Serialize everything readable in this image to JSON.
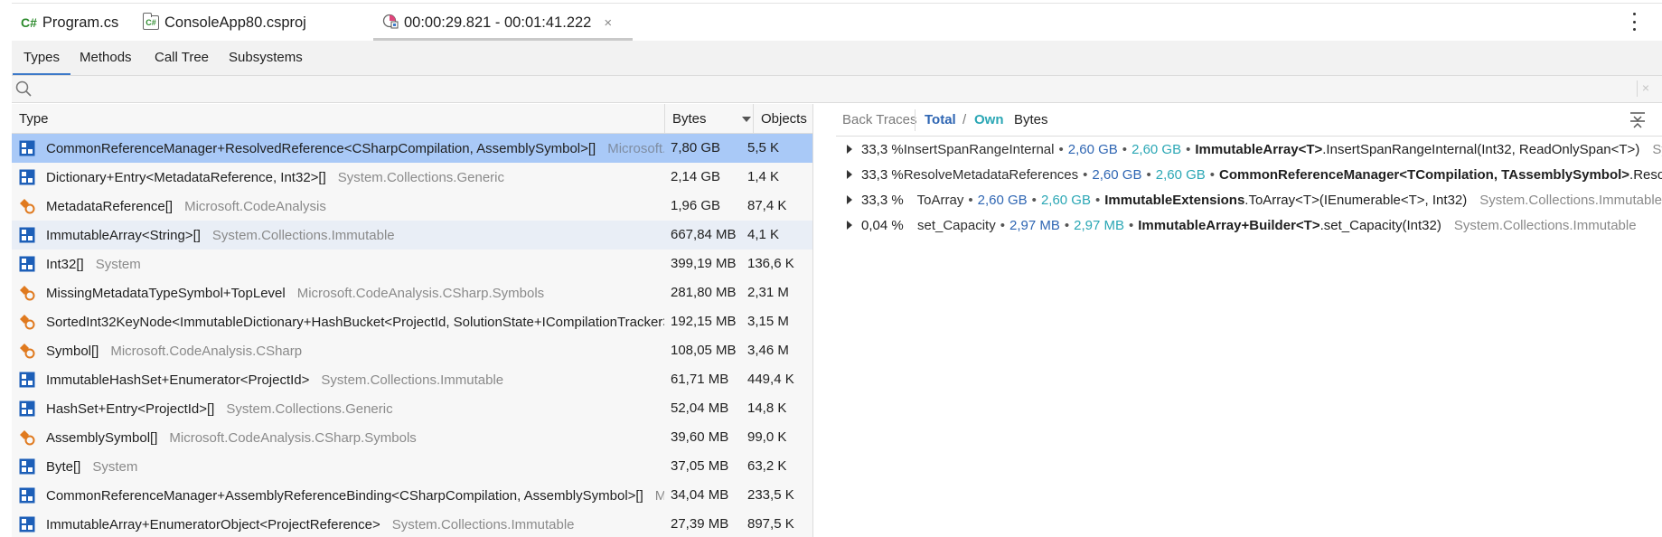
{
  "file_tabs": [
    {
      "icon": "csharp-file-icon",
      "badge": "C#",
      "label": "Program.cs"
    },
    {
      "icon": "csproj-file-icon",
      "badge": "C#",
      "label": "ConsoleApp80.csproj"
    },
    {
      "icon": "memory-snapshot-icon",
      "label": "00:00:29.821 - 00:01:41.222",
      "close": "×"
    }
  ],
  "view_tabs": [
    "Types",
    "Methods",
    "Call Tree",
    "Subsystems"
  ],
  "active_view_tab": "Types",
  "search": {
    "value": "",
    "placeholder": "",
    "clear": "×"
  },
  "table": {
    "columns": {
      "type": "Type",
      "bytes": "Bytes",
      "objects": "Objects"
    },
    "rows": [
      {
        "icon": "class-icon",
        "name": "CommonReferenceManager+ResolvedReference<CSharpCompilation, AssemblySymbol>[]",
        "ns": "Microsoft.CodeAnalysis",
        "bytes": "7,80 GB",
        "objects": "5,5 K",
        "selected": true
      },
      {
        "icon": "class-icon",
        "name": "Dictionary+Entry<MetadataReference, Int32>[]",
        "ns": "System.Collections.Generic",
        "bytes": "2,14 GB",
        "objects": "1,4 K"
      },
      {
        "icon": "abstract-class-icon",
        "name": "MetadataReference[]",
        "ns": "Microsoft.CodeAnalysis",
        "bytes": "1,96 GB",
        "objects": "87,4 K"
      },
      {
        "icon": "class-icon",
        "name": "ImmutableArray<String>[]",
        "ns": "System.Collections.Immutable",
        "bytes": "667,84 MB",
        "objects": "4,1 K",
        "hover": true
      },
      {
        "icon": "class-icon",
        "name": "Int32[]",
        "ns": "System",
        "bytes": "399,19 MB",
        "objects": "136,6 K"
      },
      {
        "icon": "abstract-class-icon",
        "name": "MissingMetadataTypeSymbol+TopLevel",
        "ns": "Microsoft.CodeAnalysis.CSharp.Symbols",
        "bytes": "281,80 MB",
        "objects": "2,31 M"
      },
      {
        "icon": "abstract-class-icon",
        "name": "SortedInt32KeyNode<ImmutableDictionary+HashBucket<ProjectId, SolutionState+ICompilationTracker>>",
        "ns": "",
        "bytes": "192,15 MB",
        "objects": "3,15 M"
      },
      {
        "icon": "abstract-class-icon",
        "name": "Symbol[]",
        "ns": "Microsoft.CodeAnalysis.CSharp",
        "bytes": "108,05 MB",
        "objects": "3,46 M"
      },
      {
        "icon": "class-icon",
        "name": "ImmutableHashSet+Enumerator<ProjectId>",
        "ns": "System.Collections.Immutable",
        "bytes": "61,71 MB",
        "objects": "449,4 K"
      },
      {
        "icon": "class-icon",
        "name": "HashSet+Entry<ProjectId>[]",
        "ns": "System.Collections.Generic",
        "bytes": "52,04 MB",
        "objects": "14,8 K"
      },
      {
        "icon": "abstract-class-icon",
        "name": "AssemblySymbol[]",
        "ns": "Microsoft.CodeAnalysis.CSharp.Symbols",
        "bytes": "39,60 MB",
        "objects": "99,0 K"
      },
      {
        "icon": "class-icon",
        "name": "Byte[]",
        "ns": "System",
        "bytes": "37,05 MB",
        "objects": "63,2 K"
      },
      {
        "icon": "class-icon",
        "name": "CommonReferenceManager+AssemblyReferenceBinding<CSharpCompilation, AssemblySymbol>[]",
        "ns": "Microsoft.CodeAnalysis",
        "bytes": "34,04 MB",
        "objects": "233,5 K"
      },
      {
        "icon": "class-icon",
        "name": "ImmutableArray+EnumeratorObject<ProjectReference>",
        "ns": "System.Collections.Immutable",
        "bytes": "27,39 MB",
        "objects": "897,5 K"
      }
    ]
  },
  "back_traces": {
    "header": {
      "back_traces": "Back Traces",
      "total": "Total",
      "slash": "/",
      "own": "Own",
      "bytes": "Bytes"
    },
    "rows": [
      {
        "pct": "33,3 %",
        "method": "InsertSpanRangeInternal",
        "total": "2,60 GB",
        "own": "2,60 GB",
        "cls": "ImmutableArray<T>",
        "call": ".InsertSpanRangeInternal(Int32, ReadOnlySpan<T>)",
        "ns": "System.Collections.Immutable"
      },
      {
        "pct": "33,3 %",
        "method": "ResolveMetadataReferences",
        "total": "2,60 GB",
        "own": "2,60 GB",
        "cls": "CommonReferenceManager<TCompilation, TAssemblySymbol>",
        "call": ".ResolveMetadataReferences(...)",
        "ns": ""
      },
      {
        "pct": "33,3 %",
        "method": "ToArray",
        "total": "2,60 GB",
        "own": "2,60 GB",
        "cls": "ImmutableExtensions",
        "call": ".ToArray<T>(IEnumerable<T>, Int32)",
        "ns": "System.Collections.Immutable"
      },
      {
        "pct": "0,04 %",
        "method": "set_Capacity",
        "total": "2,97 MB",
        "own": "2,97 MB",
        "cls": "ImmutableArray+Builder<T>",
        "call": ".set_Capacity(Int32)",
        "ns": "System.Collections.Immutable"
      }
    ]
  },
  "colors": {
    "accent": "#3c79c9",
    "selected_row": "#a9c9f7",
    "total": "#2f66b3",
    "own": "#2ba7b5",
    "class_icon": "#1d5fb8",
    "abstract_icon": "#e07a1f"
  }
}
